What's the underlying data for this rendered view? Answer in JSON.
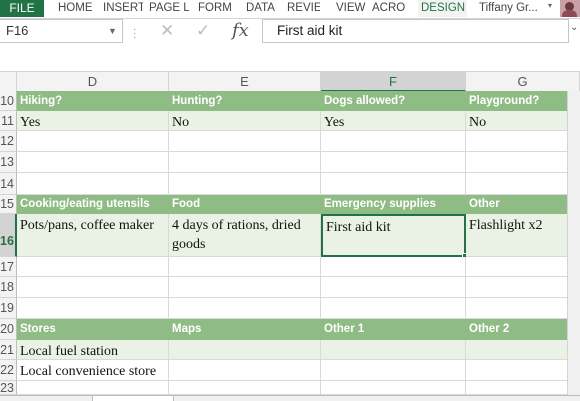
{
  "ribbon": {
    "tabs": [
      "FILE",
      "HOME",
      "INSERT",
      "PAGE L",
      "FORM",
      "DATA",
      "REVIE",
      "VIEW",
      "ACRO",
      "DESIGN"
    ],
    "user_name": "Tiffany Gr..."
  },
  "formula_bar": {
    "name_box": "F16",
    "formula": "First aid kit"
  },
  "columns": [
    "D",
    "E",
    "F",
    "G"
  ],
  "selected_column": "F",
  "rows": [
    {
      "num": "10",
      "type": "hdr",
      "cells": [
        "Hiking?",
        "Hunting?",
        "Dogs allowed?",
        "Playground?"
      ]
    },
    {
      "num": "11",
      "type": "val",
      "cells": [
        "Yes",
        "No",
        "Yes",
        "No"
      ]
    },
    {
      "num": "12",
      "type": "blank",
      "cells": [
        "",
        "",
        "",
        ""
      ]
    },
    {
      "num": "13",
      "type": "blank",
      "cells": [
        "",
        "",
        "",
        ""
      ]
    },
    {
      "num": "14",
      "type": "blank",
      "cells": [
        "",
        "",
        "",
        ""
      ]
    },
    {
      "num": "15",
      "type": "hdr",
      "cells": [
        "Cooking/eating utensils",
        "Food",
        "Emergency supplies",
        "Other"
      ]
    },
    {
      "num": "16",
      "type": "val",
      "cells": [
        "Pots/pans, coffee maker",
        "4 days of rations, dried goods",
        "First aid kit",
        "Flashlight x2"
      ]
    },
    {
      "num": "17",
      "type": "blank",
      "cells": [
        "",
        "",
        "",
        ""
      ]
    },
    {
      "num": "18",
      "type": "blank",
      "cells": [
        "",
        "",
        "",
        ""
      ]
    },
    {
      "num": "19",
      "type": "blank",
      "cells": [
        "",
        "",
        "",
        ""
      ]
    },
    {
      "num": "20",
      "type": "hdr",
      "cells": [
        "Stores",
        "Maps",
        "Other 1",
        "Other 2"
      ]
    },
    {
      "num": "21",
      "type": "val",
      "cells": [
        "Local fuel station",
        "",
        "",
        ""
      ]
    },
    {
      "num": "22",
      "type": "blank",
      "cells": [
        "Local convenience store",
        "",
        "",
        ""
      ]
    },
    {
      "num": "23",
      "type": "blank",
      "cells": [
        "",
        "",
        "",
        ""
      ]
    }
  ],
  "active_cell": {
    "row": "16",
    "column": "F"
  },
  "colors": {
    "header_fill": "#8fbc84",
    "value_fill": "#eaf2e5",
    "excel_green": "#217346"
  }
}
